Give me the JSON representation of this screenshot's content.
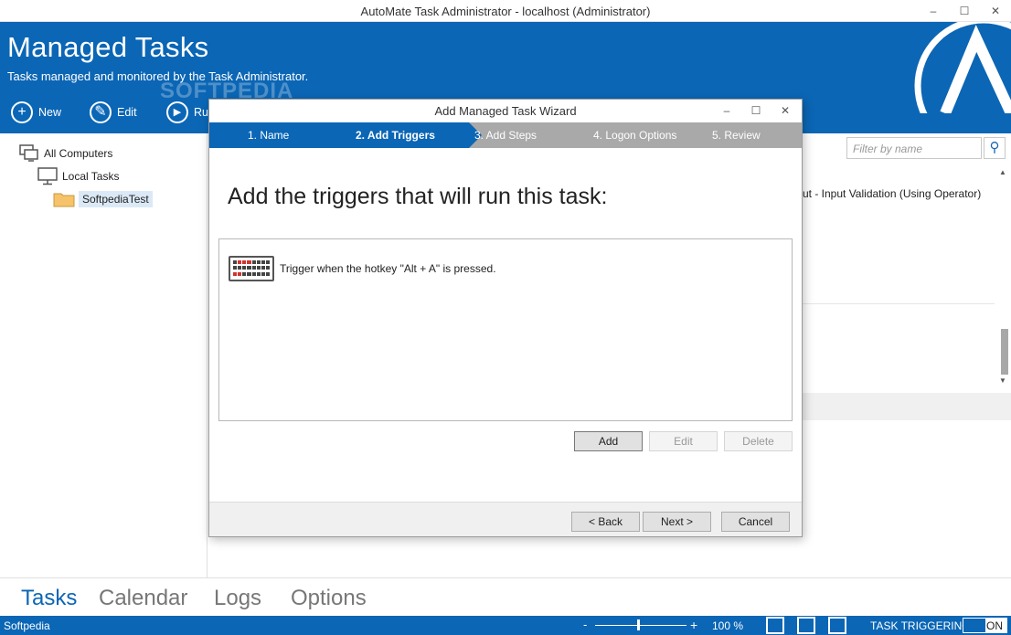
{
  "window": {
    "title": "AutoMate Task Administrator - localhost (Administrator)",
    "minimize": "‒",
    "maximize": "☐",
    "close": "✕"
  },
  "header": {
    "title": "Managed Tasks",
    "subtitle": "Tasks managed and monitored by the Task Administrator.",
    "toolbar": {
      "new_label": "New",
      "edit_label": "Edit",
      "run_label": "Ru"
    },
    "watermark": "SOFTPEDIA",
    "brand_color": "#0b66b5"
  },
  "tree": {
    "root": "All Computers",
    "child": "Local Tasks",
    "folder": "SoftpediaTest"
  },
  "right": {
    "filter_placeholder": "Filter by name",
    "partial_text": "ut - Input Validation (Using Operator)"
  },
  "wizard": {
    "title": "Add Managed Task Wizard",
    "steps": [
      "1. Name",
      "2. Add Triggers",
      "3. Add Steps",
      "4. Logon Options",
      "5. Review"
    ],
    "active_step": 1,
    "heading": "Add the triggers that will run this task:",
    "triggers": [
      {
        "icon": "keyboard-icon",
        "text": "Trigger when the hotkey \"Alt + A\" is pressed."
      }
    ],
    "buttons": {
      "add": "Add",
      "edit": "Edit",
      "delete": "Delete",
      "back": "< Back",
      "next": "Next >",
      "cancel": "Cancel"
    }
  },
  "bottom_nav": {
    "tabs": [
      "Tasks",
      "Calendar",
      "Logs",
      "Options"
    ],
    "active": "Tasks"
  },
  "statusbar": {
    "left": "Softpedia",
    "zoom_minus": "-",
    "zoom_plus": "+",
    "zoom": "100 %",
    "task_triggering_label": "TASK TRIGGERING",
    "toggle_state": "ON"
  }
}
